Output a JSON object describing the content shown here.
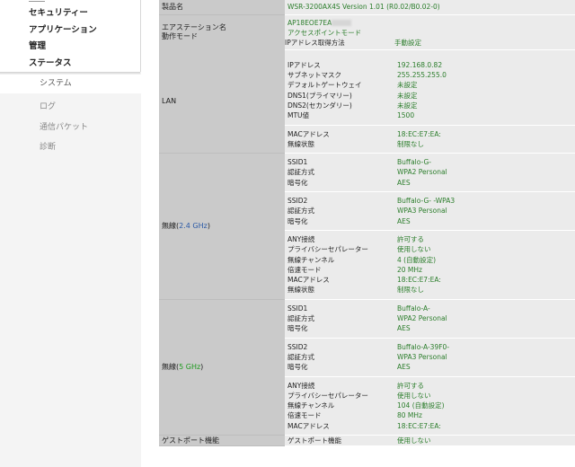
{
  "sidebar": {
    "main_items": [
      "セキュリティー",
      "アプリケーション",
      "管理",
      "ステータス"
    ],
    "active_sub": "システム",
    "sub_items": [
      "ログ",
      "通信パケット",
      "診断"
    ]
  },
  "system": {
    "product_label": "製品名",
    "product_value": "WSR-3200AX4S Version 1.01 (R0.02/B0.02-0)",
    "station_label": "エアステーション名",
    "station_value": "AP18EOE7EA",
    "mode_label": "動作モード",
    "mode_value": "アクセスポイントモード",
    "ip_method_key": "IPアドレス取得方法",
    "ip_method_val": "手動設定"
  },
  "lan": {
    "label": "LAN",
    "group1": [
      [
        "IPアドレス",
        "192.168.0.82"
      ],
      [
        "サブネットマスク",
        "255.255.255.0"
      ],
      [
        "デフォルトゲートウェイ",
        "未設定"
      ],
      [
        "DNS1(プライマリー)",
        "未設定"
      ],
      [
        "DNS2(セカンダリー)",
        "未設定"
      ],
      [
        "MTU値",
        "1500"
      ]
    ],
    "group2": [
      [
        "MACアドレス",
        "18:EC:E7:EA:"
      ],
      [
        "無線状態",
        "制限なし"
      ]
    ]
  },
  "w24": {
    "label_prefix": "無線(",
    "label_freq": "2.4 GHz",
    "label_suffix": ")",
    "ssid1": [
      [
        "SSID1",
        "Buffalo-G-"
      ],
      [
        "認証方式",
        "WPA2 Personal"
      ],
      [
        "暗号化",
        "AES"
      ]
    ],
    "ssid2": [
      [
        "SSID2",
        "Buffalo-G-      -WPA3"
      ],
      [
        "認証方式",
        "WPA3 Personal"
      ],
      [
        "暗号化",
        "AES"
      ]
    ],
    "common": [
      [
        "ANY接続",
        "許可する"
      ],
      [
        "プライバシーセパレーター",
        "使用しない"
      ],
      [
        "無線チャンネル",
        "4 (自動設定)"
      ],
      [
        "倍速モード",
        "20 MHz"
      ],
      [
        "MACアドレス",
        "18:EC:E7:EA:"
      ],
      [
        "無線状態",
        "制限なし"
      ]
    ]
  },
  "w5": {
    "label_prefix": "無線(",
    "label_freq": "5 GHz",
    "label_suffix": ")",
    "ssid1": [
      [
        "SSID1",
        "Buffalo-A-"
      ],
      [
        "認証方式",
        "WPA2 Personal"
      ],
      [
        "暗号化",
        "AES"
      ]
    ],
    "ssid2": [
      [
        "SSID2",
        "Buffalo-A-39F0-"
      ],
      [
        "認証方式",
        "WPA3 Personal"
      ],
      [
        "暗号化",
        "AES"
      ]
    ],
    "common": [
      [
        "ANY接続",
        "許可する"
      ],
      [
        "プライバシーセパレーター",
        "使用しない"
      ],
      [
        "無線チャンネル",
        "104 (自動設定)"
      ],
      [
        "倍速モード",
        "80 MHz"
      ],
      [
        "MACアドレス",
        "18:EC:E7:EA:"
      ]
    ]
  },
  "guest": {
    "label": "ゲストポート機能",
    "rows": [
      [
        "ゲストポート機能",
        "使用しない"
      ]
    ]
  }
}
